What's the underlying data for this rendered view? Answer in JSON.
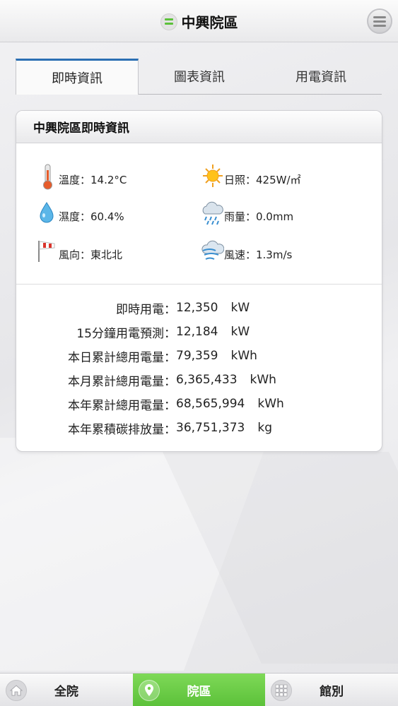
{
  "header": {
    "title": "中興院區"
  },
  "tabs": [
    {
      "label": "即時資訊",
      "active": true
    },
    {
      "label": "圖表資訊",
      "active": false
    },
    {
      "label": "用電資訊",
      "active": false
    }
  ],
  "card": {
    "title": "中興院區即時資訊",
    "weather": {
      "temperature": "溫度：14.2°C",
      "sunlight": "日照：425W/㎡",
      "humidity": "濕度：60.4%",
      "rainfall": "雨量：0.0mm",
      "wind_direction": "風向：東北北",
      "wind_speed": "風速：1.3m/s"
    },
    "power": [
      {
        "label": "即時用電：",
        "value": "12,350",
        "unit": "kW"
      },
      {
        "label": "15分鐘用電預測：",
        "value": "12,184",
        "unit": "kW"
      },
      {
        "label": "本日累計總用電量：",
        "value": "79,359",
        "unit": "kWh"
      },
      {
        "label": "本月累計總用電量：",
        "value": "6,365,433",
        "unit": "kWh"
      },
      {
        "label": "本年累計總用電量：",
        "value": "68,565,994",
        "unit": "kWh"
      },
      {
        "label": "本年累積碳排放量：",
        "value": "36,751,373",
        "unit": "kg"
      }
    ]
  },
  "bottom_nav": [
    {
      "label": "全院",
      "icon": "home-icon",
      "active": false
    },
    {
      "label": "院區",
      "icon": "location-pin-icon",
      "active": true
    },
    {
      "label": "館別",
      "icon": "grid-icon",
      "active": false
    }
  ],
  "colors": {
    "accent_green": "#5cc13a",
    "tab_active_blue": "#2b6fb3"
  }
}
